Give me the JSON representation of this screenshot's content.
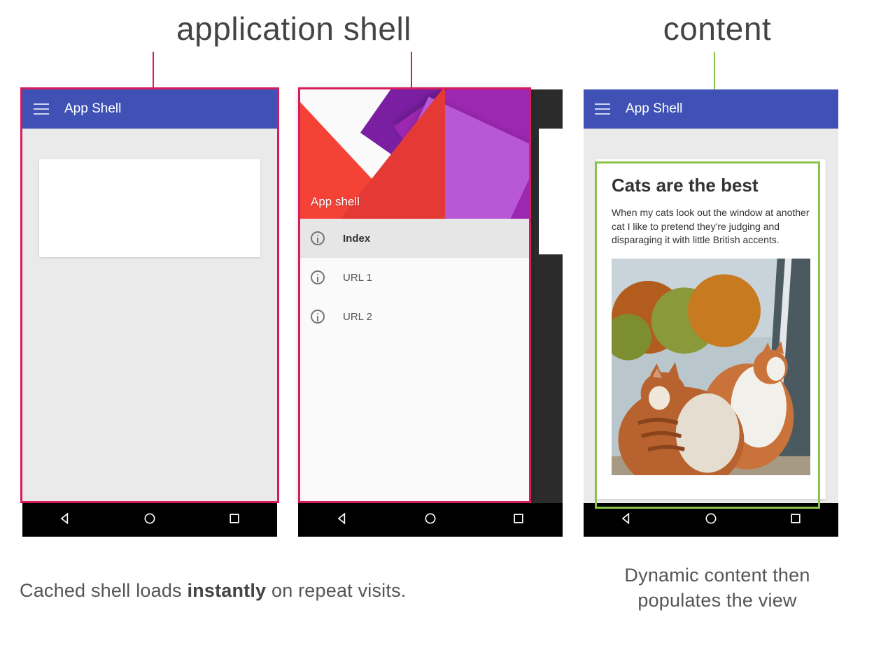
{
  "labels": {
    "application_shell": "application shell",
    "content": "content"
  },
  "app": {
    "title": "App Shell",
    "drawer_title": "App shell",
    "drawer_items": [
      {
        "label": "Index",
        "active": true
      },
      {
        "label": "URL 1",
        "active": false
      },
      {
        "label": "URL 2",
        "active": false
      }
    ]
  },
  "article": {
    "heading": "Cats are the best",
    "body": "When my cats look out the window at another cat I like to pretend they're judging and disparaging it with little British accents."
  },
  "captions": {
    "left_pre": "Cached shell loads ",
    "left_bold": "instantly",
    "left_post": " on repeat visits.",
    "right": "Dynamic content then populates the view"
  },
  "colors": {
    "appbar": "#3f51b5",
    "highlight_shell": "#d81b60",
    "highlight_content": "#8bc34a"
  },
  "icons": {
    "menu": "hamburger-icon",
    "info": "info-icon",
    "back": "triangle-back-icon",
    "home": "circle-home-icon",
    "recents": "square-recents-icon"
  }
}
